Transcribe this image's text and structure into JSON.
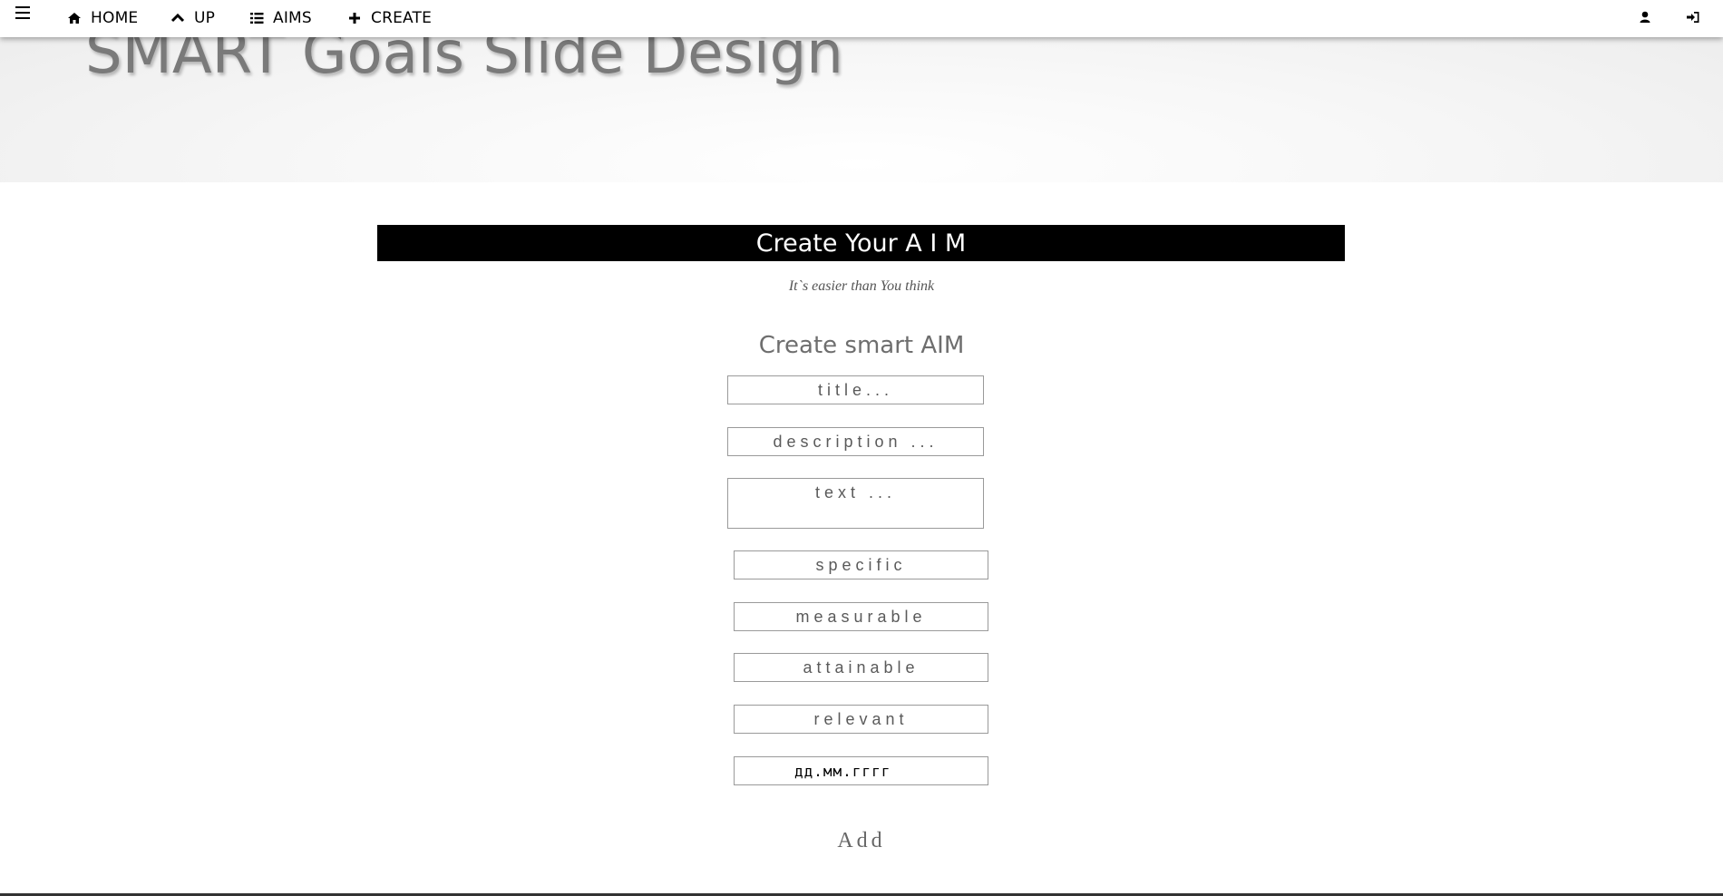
{
  "nav": {
    "home_label": "HOME",
    "up_label": "UP",
    "aims_label": "AIMS",
    "create_label": "CREATE",
    "icons": [
      "menu-icon",
      "home-icon",
      "chevron-up-icon",
      "list-icon",
      "plus-icon",
      "user-icon",
      "sign-in-icon"
    ]
  },
  "hero": {
    "title": "SMART Goals Slide Design"
  },
  "main": {
    "header": "Create Your A I M",
    "subtitle": "It`s easier than You think",
    "form_title": "Create smart AIM",
    "fields": {
      "title_placeholder": "title...",
      "description_placeholder": "description ...",
      "text_placeholder": "text ...",
      "specific_placeholder": "specific",
      "measurable_placeholder": "measurable",
      "attainable_placeholder": "attainable",
      "relevant_placeholder": "relevant",
      "date_value": "дд.мм.гггг"
    },
    "add_label": "Add"
  },
  "colors": {
    "header_bg": "#000000",
    "header_text": "#ffffff",
    "hero_text": "#7a7a7a",
    "field_border": "#9a9a9a"
  }
}
